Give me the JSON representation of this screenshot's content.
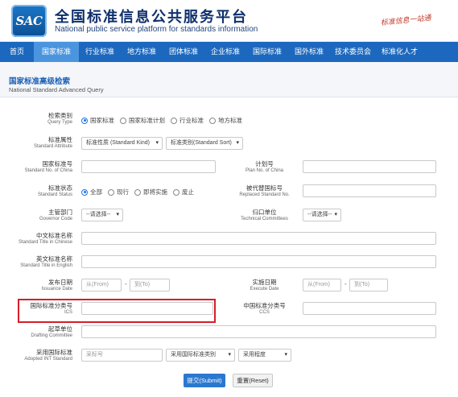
{
  "header": {
    "logo_text": "SAC",
    "title": "全国标准信息公共服务平台",
    "subtitle": "National public service platform  for standards information",
    "slogan": "标准信息一站通"
  },
  "nav": [
    "首页",
    "国家标准",
    "行业标准",
    "地方标准",
    "团体标准",
    "企业标准",
    "国际标准",
    "国外标准",
    "技术委员会",
    "标准化人才"
  ],
  "panel": {
    "title": "国家标准高级检索",
    "subtitle": "National Standard Advanced Query"
  },
  "form": {
    "query_type": {
      "zh": "检索类别",
      "en": "Query Type",
      "options": [
        "国家标准",
        "国家标准计划",
        "行业标准",
        "地方标准"
      ]
    },
    "attribute": {
      "zh": "标准属性",
      "en": "Standard Attribute",
      "kind": "标准性质 (Standard Kind)",
      "sort": "标准类别(Standard Sort)"
    },
    "std_no": {
      "zh": "国家标准号",
      "en": "Standard No. of China"
    },
    "plan_no": {
      "zh": "计划号",
      "en": "Plan No. of China"
    },
    "status": {
      "zh": "标准状态",
      "en": "Standard Status",
      "options": [
        "全部",
        "现行",
        "即将实施",
        "废止"
      ]
    },
    "replaced": {
      "zh": "被代替国标号",
      "en": "Replaced Standard No."
    },
    "governor": {
      "zh": "主管部门",
      "en": "Governor Code",
      "value": "--请选择--"
    },
    "tc": {
      "zh": "归口单位",
      "en": "Technical Committees",
      "value": "--请选择--"
    },
    "title_cn": {
      "zh": "中文标准名称",
      "en": "Standard Title in Chinese"
    },
    "title_en": {
      "zh": "英文标准名称",
      "en": "Standard Title in English"
    },
    "issue_date": {
      "zh": "发布日期",
      "en": "Issuance Date",
      "from": "从(From)",
      "to": "到(To)"
    },
    "exec_date": {
      "zh": "实施日期",
      "en": "Execute Date",
      "from": "从(From)",
      "to": "到(To)"
    },
    "ics": {
      "zh": "国际标准分类号",
      "en": "ICS"
    },
    "ccs": {
      "zh": "中国标准分类号",
      "en": "CCS"
    },
    "drafting": {
      "zh": "起草单位",
      "en": "Drafting Committee"
    },
    "adopted": {
      "zh": "采用国际标准",
      "en": "Adopted INT Standard",
      "no_placeholder": "采标号",
      "cat": "采用国际标准类别",
      "degree": "采用程度"
    },
    "dash": "-",
    "submit": "提交(Submit)",
    "reset": "重置(Reset)"
  },
  "colors": {
    "nav": "#1c68be",
    "nav_active": "#4b95df",
    "accent": "#1a73e8",
    "highlight": "#d51e27"
  }
}
